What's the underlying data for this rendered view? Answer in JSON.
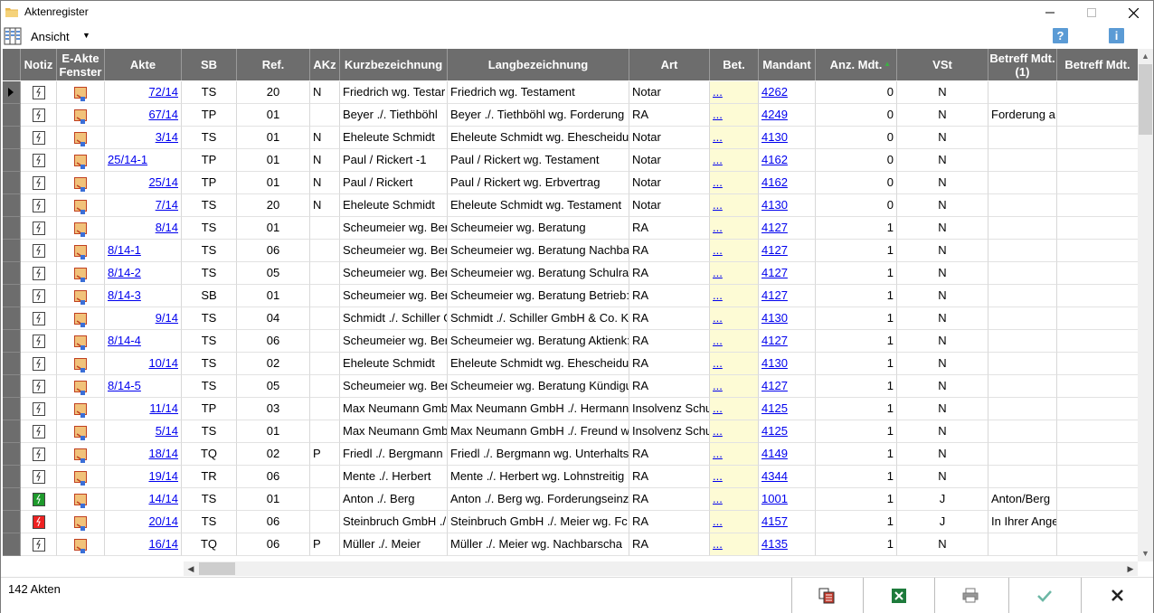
{
  "window": {
    "title": "Aktenregister"
  },
  "toolbar": {
    "view_label": "Ansicht",
    "help": "?",
    "info": "i"
  },
  "columns": [
    {
      "key": "notiz",
      "label": "Notiz",
      "w": 40
    },
    {
      "key": "efenster",
      "label": "E-Akte Fenster",
      "w": 53
    },
    {
      "key": "akte",
      "label": "Akte",
      "w": 85
    },
    {
      "key": "sb",
      "label": "SB",
      "w": 61
    },
    {
      "key": "ref",
      "label": "Ref.",
      "w": 81
    },
    {
      "key": "akz",
      "label": "AKz",
      "w": 33
    },
    {
      "key": "kurz",
      "label": "Kurzbezeichnung",
      "w": 119
    },
    {
      "key": "lang",
      "label": "Langbezeichnung",
      "w": 201
    },
    {
      "key": "art",
      "label": "Art",
      "w": 89
    },
    {
      "key": "bet",
      "label": "Bet.",
      "w": 54
    },
    {
      "key": "mandant",
      "label": "Mandant",
      "w": 63
    },
    {
      "key": "anz",
      "label": "Anz. Mdt.",
      "w": 90
    },
    {
      "key": "vst",
      "label": "VSt",
      "w": 101
    },
    {
      "key": "betreff1",
      "label": "Betreff Mdt. (1)",
      "w": 76
    },
    {
      "key": "betreffm",
      "label": "Betreff Mdt.",
      "w": 90
    }
  ],
  "rows": [
    {
      "notiz": "w",
      "akte": "72/14",
      "akte_right": true,
      "sb": "TS",
      "ref": "20",
      "akz": "N",
      "kurz": "Friedrich wg. Testar",
      "lang": "Friedrich wg. Testament",
      "art": "Notar",
      "bet": "...",
      "mandant": "4262",
      "anz": "0",
      "vst": "N",
      "betreff1": ""
    },
    {
      "notiz": "w",
      "akte": "67/14",
      "akte_right": true,
      "sb": "TP",
      "ref": "01",
      "akz": "",
      "kurz": "Beyer ./. Tiethböhl",
      "lang": "Beyer ./. Tiethböhl wg. Forderung",
      "art": "RA",
      "bet": "...",
      "mandant": "4249",
      "anz": "0",
      "vst": "N",
      "betreff1": "Forderung a"
    },
    {
      "notiz": "w",
      "akte": "3/14",
      "akte_right": true,
      "sb": "TS",
      "ref": "01",
      "akz": "N",
      "kurz": "Eheleute Schmidt",
      "lang": "Eheleute Schmidt wg. Ehescheidu",
      "art": "Notar",
      "bet": "...",
      "mandant": "4130",
      "anz": "0",
      "vst": "N",
      "betreff1": ""
    },
    {
      "notiz": "w",
      "akte": "25/14-1",
      "akte_right": false,
      "sb": "TP",
      "ref": "01",
      "akz": "N",
      "kurz": "Paul / Rickert -1",
      "lang": "Paul / Rickert wg. Testament",
      "art": "Notar",
      "bet": "...",
      "mandant": "4162",
      "anz": "0",
      "vst": "N",
      "betreff1": ""
    },
    {
      "notiz": "w",
      "akte": "25/14",
      "akte_right": true,
      "sb": "TP",
      "ref": "01",
      "akz": "N",
      "kurz": "Paul / Rickert",
      "lang": "Paul / Rickert wg. Erbvertrag",
      "art": "Notar",
      "bet": "...",
      "mandant": "4162",
      "anz": "0",
      "vst": "N",
      "betreff1": ""
    },
    {
      "notiz": "w",
      "akte": "7/14",
      "akte_right": true,
      "sb": "TS",
      "ref": "20",
      "akz": "N",
      "kurz": "Eheleute Schmidt",
      "lang": "Eheleute Schmidt wg. Testament",
      "art": "Notar",
      "bet": "...",
      "mandant": "4130",
      "anz": "0",
      "vst": "N",
      "betreff1": ""
    },
    {
      "notiz": "w",
      "akte": "8/14",
      "akte_right": true,
      "sb": "TS",
      "ref": "01",
      "akz": "",
      "kurz": "Scheumeier wg. Ber",
      "lang": "Scheumeier wg. Beratung",
      "art": "RA",
      "bet": "...",
      "mandant": "4127",
      "anz": "1",
      "vst": "N",
      "betreff1": ""
    },
    {
      "notiz": "w",
      "akte": "8/14-1",
      "akte_right": false,
      "sb": "TS",
      "ref": "06",
      "akz": "",
      "kurz": "Scheumeier wg. Ber",
      "lang": "Scheumeier wg. Beratung Nachba",
      "art": "RA",
      "bet": "...",
      "mandant": "4127",
      "anz": "1",
      "vst": "N",
      "betreff1": ""
    },
    {
      "notiz": "w",
      "akte": "8/14-2",
      "akte_right": false,
      "sb": "TS",
      "ref": "05",
      "akz": "",
      "kurz": "Scheumeier wg. Ber",
      "lang": "Scheumeier wg. Beratung Schulra",
      "art": "RA",
      "bet": "...",
      "mandant": "4127",
      "anz": "1",
      "vst": "N",
      "betreff1": ""
    },
    {
      "notiz": "w",
      "akte": "8/14-3",
      "akte_right": false,
      "sb": "SB",
      "ref": "01",
      "akz": "",
      "kurz": "Scheumeier wg. Ber",
      "lang": "Scheumeier wg. Beratung Betrieb:",
      "art": "RA",
      "bet": "...",
      "mandant": "4127",
      "anz": "1",
      "vst": "N",
      "betreff1": ""
    },
    {
      "notiz": "w",
      "akte": "9/14",
      "akte_right": true,
      "sb": "TS",
      "ref": "04",
      "akz": "",
      "kurz": "Schmidt ./. Schiller G",
      "lang": "Schmidt ./. Schiller GmbH & Co. K",
      "art": "RA",
      "bet": "...",
      "mandant": "4130",
      "anz": "1",
      "vst": "N",
      "betreff1": ""
    },
    {
      "notiz": "w",
      "akte": "8/14-4",
      "akte_right": false,
      "sb": "TS",
      "ref": "06",
      "akz": "",
      "kurz": "Scheumeier wg. Ber",
      "lang": "Scheumeier wg. Beratung Aktienk:",
      "art": "RA",
      "bet": "...",
      "mandant": "4127",
      "anz": "1",
      "vst": "N",
      "betreff1": ""
    },
    {
      "notiz": "w",
      "akte": "10/14",
      "akte_right": true,
      "sb": "TS",
      "ref": "02",
      "akz": "",
      "kurz": "Eheleute Schmidt",
      "lang": "Eheleute Schmidt wg. Ehescheidu",
      "art": "RA",
      "bet": "...",
      "mandant": "4130",
      "anz": "1",
      "vst": "N",
      "betreff1": ""
    },
    {
      "notiz": "w",
      "akte": "8/14-5",
      "akte_right": false,
      "sb": "TS",
      "ref": "05",
      "akz": "",
      "kurz": "Scheumeier wg. Ber",
      "lang": "Scheumeier wg. Beratung Kündigu",
      "art": "RA",
      "bet": "...",
      "mandant": "4127",
      "anz": "1",
      "vst": "N",
      "betreff1": ""
    },
    {
      "notiz": "w",
      "akte": "11/14",
      "akte_right": true,
      "sb": "TP",
      "ref": "03",
      "akz": "",
      "kurz": "Max Neumann GmbH",
      "lang": "Max Neumann GmbH ./. Hermann",
      "art": "Insolvenz Schu",
      "bet": "...",
      "mandant": "4125",
      "anz": "1",
      "vst": "N",
      "betreff1": ""
    },
    {
      "notiz": "w",
      "akte": "5/14",
      "akte_right": true,
      "sb": "TS",
      "ref": "01",
      "akz": "",
      "kurz": "Max Neumann GmbH",
      "lang": "Max Neumann GmbH ./. Freund w",
      "art": "Insolvenz Schu",
      "bet": "...",
      "mandant": "4125",
      "anz": "1",
      "vst": "N",
      "betreff1": ""
    },
    {
      "notiz": "w",
      "akte": "18/14",
      "akte_right": true,
      "sb": "TQ",
      "ref": "02",
      "akz": "P",
      "kurz": "Friedl ./. Bergmann",
      "lang": "Friedl ./. Bergmann wg. Unterhalts",
      "art": "RA",
      "bet": "...",
      "mandant": "4149",
      "anz": "1",
      "vst": "N",
      "betreff1": ""
    },
    {
      "notiz": "w",
      "akte": "19/14",
      "akte_right": true,
      "sb": "TR",
      "ref": "06",
      "akz": "",
      "kurz": "Mente ./. Herbert",
      "lang": "Mente ./. Herbert wg. Lohnstreitig",
      "art": "RA",
      "bet": "...",
      "mandant": "4344",
      "anz": "1",
      "vst": "N",
      "betreff1": ""
    },
    {
      "notiz": "g",
      "akte": "14/14",
      "akte_right": true,
      "sb": "TS",
      "ref": "01",
      "akz": "",
      "kurz": "Anton ./. Berg",
      "lang": "Anton ./. Berg wg. Forderungseinz",
      "art": "RA",
      "bet": "...",
      "mandant": "1001",
      "anz": "1",
      "vst": "J",
      "betreff1": "Anton/Berg"
    },
    {
      "notiz": "r",
      "akte": "20/14",
      "akte_right": true,
      "sb": "TS",
      "ref": "06",
      "akz": "",
      "kurz": "Steinbruch GmbH ./",
      "lang": "Steinbruch GmbH ./. Meier wg. Fc",
      "art": "RA",
      "bet": "...",
      "mandant": "4157",
      "anz": "1",
      "vst": "J",
      "betreff1": "In Ihrer Ange"
    },
    {
      "notiz": "w",
      "akte": "16/14",
      "akte_right": true,
      "sb": "TQ",
      "ref": "06",
      "akz": "P",
      "kurz": "Müller ./. Meier",
      "lang": "Müller ./. Meier wg. Nachbarscha",
      "art": "RA",
      "bet": "...",
      "mandant": "4135",
      "anz": "1",
      "vst": "N",
      "betreff1": ""
    }
  ],
  "footer": {
    "count": "142 Akten"
  },
  "colors": {
    "header_bg": "#6d6d6d",
    "bet_bg": "#fdfbd5",
    "link": "#0000ee",
    "sort_arrow": "#3cb043"
  }
}
